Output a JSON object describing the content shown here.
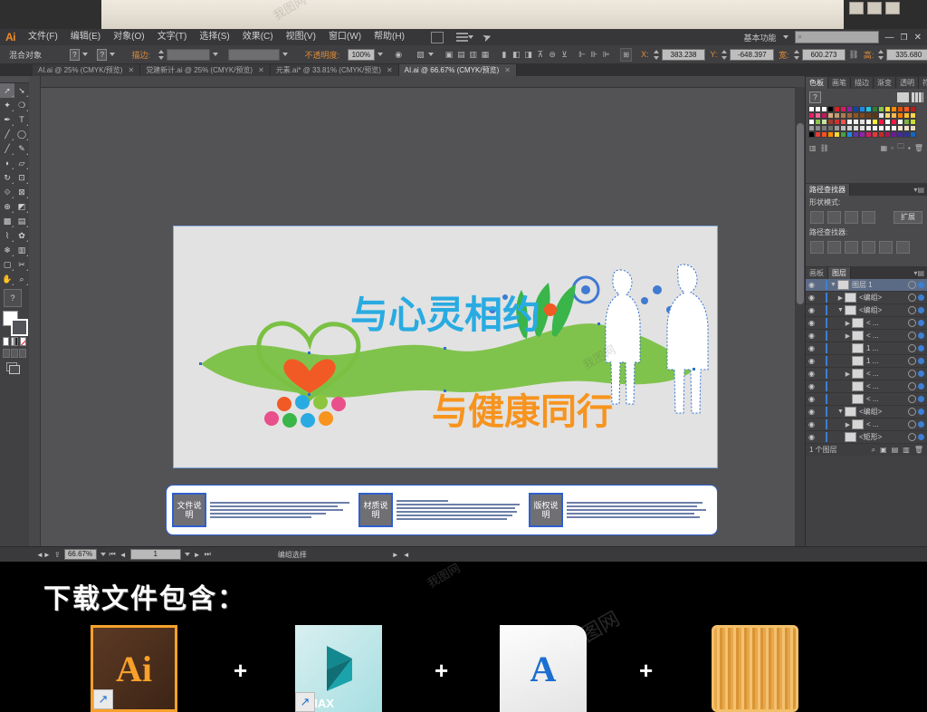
{
  "app": {
    "name": "Ai",
    "workspace": "基本功能",
    "search_placeholder": "",
    "window_buttons": [
      "minimize",
      "restore",
      "close"
    ]
  },
  "menubar": {
    "items": [
      {
        "label": "文件(F)"
      },
      {
        "label": "编辑(E)"
      },
      {
        "label": "对象(O)"
      },
      {
        "label": "文字(T)"
      },
      {
        "label": "选择(S)"
      },
      {
        "label": "效果(C)"
      },
      {
        "label": "视图(V)"
      },
      {
        "label": "窗口(W)"
      },
      {
        "label": "帮助(H)"
      }
    ]
  },
  "optionsbar": {
    "object_label": "混合对象",
    "stroke_label": "描边:",
    "opacity_label": "不透明度:",
    "opacity_value": "100%",
    "fields": {
      "x_label": "X:",
      "x_value": "383.238",
      "y_label": "Y:",
      "y_value": "-648.397",
      "w_label": "宽:",
      "w_value": "600.273",
      "h_label": "高:",
      "h_value": "335.680"
    }
  },
  "doctabs": [
    {
      "label": "AI.ai @ 25% (CMYK/预览)",
      "close": "✕",
      "active": false
    },
    {
      "label": "党建新计.ai @ 25% (CMYK/预览)",
      "close": "✕",
      "active": false
    },
    {
      "label": "元素.ai* @ 33.81% (CMYK/预览)",
      "close": "✕",
      "active": false
    },
    {
      "label": "AI.ai @ 66.67% (CMYK/预览)",
      "close": "✕",
      "active": true
    }
  ],
  "toolbar": {
    "tools": [
      "selection-tool",
      "direct-selection-tool",
      "magic-wand-tool",
      "lasso-tool",
      "pen-tool",
      "type-tool",
      "line-segment-tool",
      "ellipse-tool",
      "paintbrush-tool",
      "pencil-tool",
      "blob-brush-tool",
      "eraser-tool",
      "rotate-tool",
      "scale-tool",
      "width-tool",
      "free-transform-tool",
      "shape-builder-tool",
      "perspective-grid-tool",
      "mesh-tool",
      "gradient-tool",
      "eyedropper-tool",
      "blend-tool",
      "symbol-sprayer-tool",
      "column-graph-tool",
      "artboard-tool",
      "slice-tool",
      "hand-tool",
      "zoom-tool"
    ]
  },
  "canvas": {
    "artwork": {
      "headline_top": "与心灵相约",
      "headline_bottom": "与健康同行",
      "info_blocks": [
        {
          "title": "文件说明"
        },
        {
          "title": "材质说明"
        },
        {
          "title": "版权说明"
        }
      ]
    }
  },
  "statusbar": {
    "zoom_value": "66.67%",
    "page_value": "1",
    "status_text": "编组选择"
  },
  "panels": {
    "swatches": {
      "tabs": [
        "色板",
        "画笔",
        "描边",
        "渐变",
        "透明",
        "符号"
      ],
      "active_tab": "色板",
      "menu_glyph": "▾▤",
      "colors": [
        "#ffffff",
        "#ffffff",
        "#ffffff",
        "#000000",
        "#e01b24",
        "#d81b60",
        "#8e24aa",
        "#0d47a1",
        "#1e88e5",
        "#26c6da",
        "#2e7d32",
        "#8bc34a",
        "#fdd835",
        "#fb8c00",
        "#e65100",
        "#ff5722",
        "#b71c1c",
        "#e91e63",
        "#f06292",
        "#c2185b",
        "#d7a87d",
        "#c49a6c",
        "#b07b4f",
        "#a0663a",
        "#8d5524",
        "#7b4a1e",
        "#6b3f18",
        "#5d3712",
        "#e0e0e0",
        "#f5d76e",
        "#ffb74d",
        "#f57c00",
        "#fbc02d",
        "#ffd54f",
        "#ffffff",
        "#8bc34a",
        "#c5e1a5",
        "#a33c2a",
        "#d32f2f",
        "#ef5350",
        "#f5f5f5",
        "#eeeeee",
        "#e0e0e0",
        "#fafafa",
        "#ffeb3b",
        "#ff1744",
        "#ffffff",
        "#ff1744",
        "#ffffff",
        "#7cb342",
        "#cddc39",
        "#9e9e9e",
        "#8a8a8a",
        "#7a7a7a",
        "#6e6e6e",
        "#9c9c9c",
        "#bdbdbd",
        "#cfcfcf",
        "#dddddd",
        "#e4e4e4",
        "#eeeeee",
        "#f2f2f2",
        "#f6f6f6",
        "#f8f8f8",
        "#fafafa",
        "#f3e9d2",
        "#efe3c8",
        "#eadcbb",
        "#000000",
        "#e53935",
        "#f4511e",
        "#fb8c00",
        "#fdd835",
        "#43a047",
        "#1e88e5",
        "#5e35b1",
        "#8e24aa",
        "#d81b60",
        "#e53935",
        "#c62828",
        "#ad1457",
        "#6a1b9a",
        "#4527a0",
        "#283593",
        "#1565c0"
      ]
    },
    "pathfinder": {
      "tabs": [
        "路径查找器"
      ],
      "shape_modes_label": "形状模式:",
      "expand_label": "扩展",
      "pathfinders_label": "路径查找器:",
      "shape_mode_buttons": [
        "unite",
        "minus-front",
        "intersect",
        "exclude"
      ],
      "pathfinder_buttons": [
        "divide",
        "trim",
        "merge",
        "crop",
        "outline",
        "minus-back"
      ]
    },
    "layers": {
      "tabs": [
        "画板",
        "图层"
      ],
      "active_tab": "图层",
      "rows": [
        {
          "name": "图层 1",
          "indent": 0,
          "selected": true,
          "twisty": "▼"
        },
        {
          "name": "<编组>",
          "indent": 1,
          "selected": false,
          "twisty": "▶"
        },
        {
          "name": "<编组>",
          "indent": 1,
          "selected": false,
          "twisty": "▼"
        },
        {
          "name": "< ...",
          "indent": 2,
          "selected": false,
          "twisty": "▶"
        },
        {
          "name": "< ...",
          "indent": 2,
          "selected": false,
          "twisty": "▶"
        },
        {
          "name": "1 ...",
          "indent": 2,
          "selected": false,
          "twisty": ""
        },
        {
          "name": "1 ...",
          "indent": 2,
          "selected": false,
          "twisty": ""
        },
        {
          "name": "< ...",
          "indent": 2,
          "selected": false,
          "twisty": "▶"
        },
        {
          "name": "< ...",
          "indent": 2,
          "selected": false,
          "twisty": ""
        },
        {
          "name": "< ...",
          "indent": 2,
          "selected": false,
          "twisty": ""
        },
        {
          "name": "<编组>",
          "indent": 1,
          "selected": false,
          "twisty": "▼"
        },
        {
          "name": "< ...",
          "indent": 2,
          "selected": false,
          "twisty": "▶"
        },
        {
          "name": "<矩形>",
          "indent": 1,
          "selected": false,
          "twisty": ""
        }
      ],
      "footer_count": "1 个图层"
    }
  },
  "download": {
    "title": "下载文件包含：",
    "plus": "+",
    "items": [
      {
        "name": "ai-file-icon",
        "label": "Ai"
      },
      {
        "name": "3dsmax-file-icon",
        "label": "MAX"
      },
      {
        "name": "font-file-icon",
        "label": "A"
      },
      {
        "name": "wood-texture-icon",
        "label": ""
      }
    ]
  },
  "watermark": {
    "text": "我图网"
  }
}
